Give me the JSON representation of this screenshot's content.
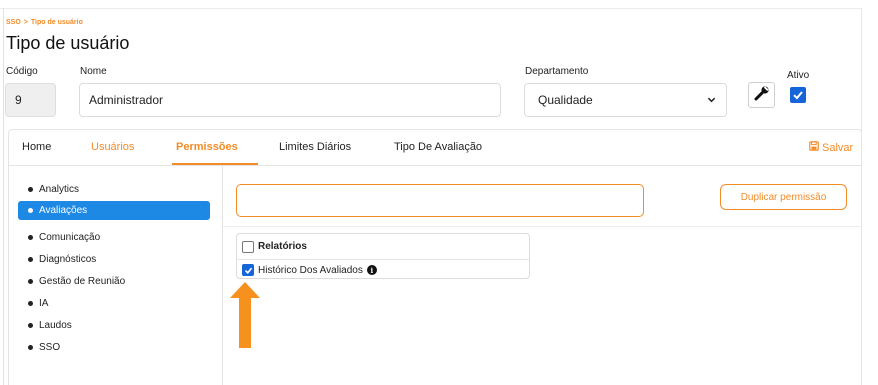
{
  "breadcrumb": {
    "root": "SSO",
    "separator": ">",
    "current": "Tipo de usuário"
  },
  "page_title": "Tipo de usuário",
  "form": {
    "codigo_label": "Código",
    "codigo_value": "9",
    "nome_label": "Nome",
    "nome_value": "Administrador",
    "departamento_label": "Departamento",
    "departamento_value": "Qualidade",
    "ativo_label": "Ativo",
    "ativo_checked": true
  },
  "tabs": [
    {
      "label": "Home"
    },
    {
      "label": "Usuários"
    },
    {
      "label": "Permissões",
      "active": true
    },
    {
      "label": "Limites Diários"
    },
    {
      "label": "Tipo De Avaliação"
    }
  ],
  "save_label": "Salvar",
  "sidebar": {
    "items": [
      {
        "label": "Analytics"
      },
      {
        "label": "Avaliações",
        "active": true
      },
      {
        "label": "Comunicação"
      },
      {
        "label": "Diagnósticos"
      },
      {
        "label": "Gestão de Reunião"
      },
      {
        "label": "IA"
      },
      {
        "label": "Laudos"
      },
      {
        "label": "SSO"
      }
    ]
  },
  "search": {
    "value": ""
  },
  "duplicate_label": "Duplicar permissão",
  "permissions": {
    "group_label": "Relatórios",
    "group_checked": false,
    "items": [
      {
        "label": "Histórico Dos Avaliados",
        "checked": true
      }
    ]
  },
  "colors": {
    "accent": "#f28c28",
    "active_blue": "#1e88e5",
    "checkbox_blue": "#1565d8"
  }
}
